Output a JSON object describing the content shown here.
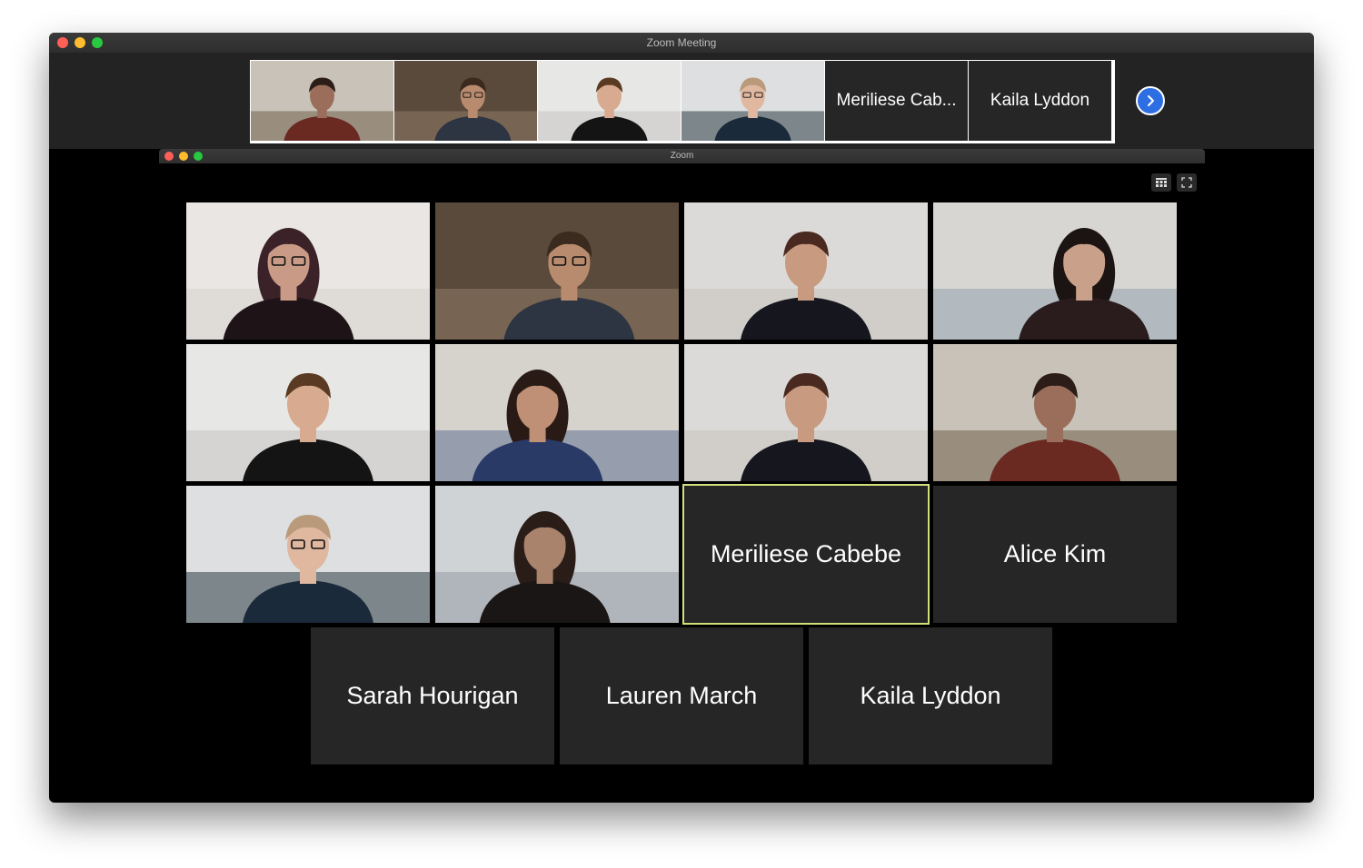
{
  "window": {
    "title": "Zoom Meeting",
    "inner_title": "Zoom"
  },
  "filmstrip": {
    "tiles": [
      {
        "type": "video",
        "scene": "window-room"
      },
      {
        "type": "video",
        "scene": "shelf-room"
      },
      {
        "type": "video",
        "scene": "white-room"
      },
      {
        "type": "video",
        "scene": "chair-room"
      },
      {
        "type": "name",
        "label": "Meriliese Cab..."
      },
      {
        "type": "name",
        "label": "Kaila Lyddon"
      }
    ],
    "next_icon": "chevron-right-icon"
  },
  "gallery": {
    "tiles": [
      {
        "type": "video",
        "scene": "white-wall"
      },
      {
        "type": "video",
        "scene": "shelf-room"
      },
      {
        "type": "video",
        "scene": "plain-wall"
      },
      {
        "type": "video",
        "scene": "office"
      },
      {
        "type": "video",
        "scene": "white-room"
      },
      {
        "type": "video",
        "scene": "painting-wall"
      },
      {
        "type": "video",
        "scene": "plain-wall"
      },
      {
        "type": "video",
        "scene": "window-room"
      },
      {
        "type": "video",
        "scene": "chair-room"
      },
      {
        "type": "video",
        "scene": "tower-window"
      },
      {
        "type": "name",
        "label": "Meriliese Cabebe",
        "active": true
      },
      {
        "type": "name",
        "label": "Alice Kim"
      },
      {
        "type": "name",
        "label": "Sarah Hourigan"
      },
      {
        "type": "name",
        "label": "Lauren March"
      },
      {
        "type": "name",
        "label": "Kaila Lyddon"
      }
    ]
  },
  "colors": {
    "active_speaker_border": "#d3e07a",
    "tile_bg": "#262626",
    "next_button": "#2d6fe3"
  }
}
